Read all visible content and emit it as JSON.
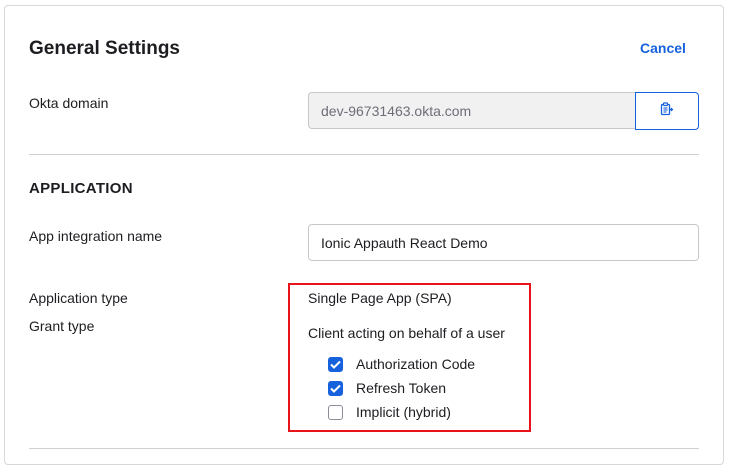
{
  "header": {
    "title": "General Settings",
    "cancel_label": "Cancel"
  },
  "okta_domain": {
    "label": "Okta domain",
    "value": "dev-96731463.okta.com",
    "copy_icon": "clipboard-icon"
  },
  "application": {
    "heading": "APPLICATION",
    "integration_name_label": "App integration name",
    "integration_name_value": "Ionic Appauth React Demo",
    "type_label": "Application type",
    "type_value": "Single Page App (SPA)",
    "grant_type_label": "Grant type",
    "grant_type_subtitle": "Client acting on behalf of a user",
    "grant_types": [
      {
        "label": "Authorization Code",
        "checked": true
      },
      {
        "label": "Refresh Token",
        "checked": true
      },
      {
        "label": "Implicit (hybrid)",
        "checked": false
      }
    ]
  },
  "colors": {
    "accent": "#1662dd",
    "highlight": "#e8141a"
  }
}
